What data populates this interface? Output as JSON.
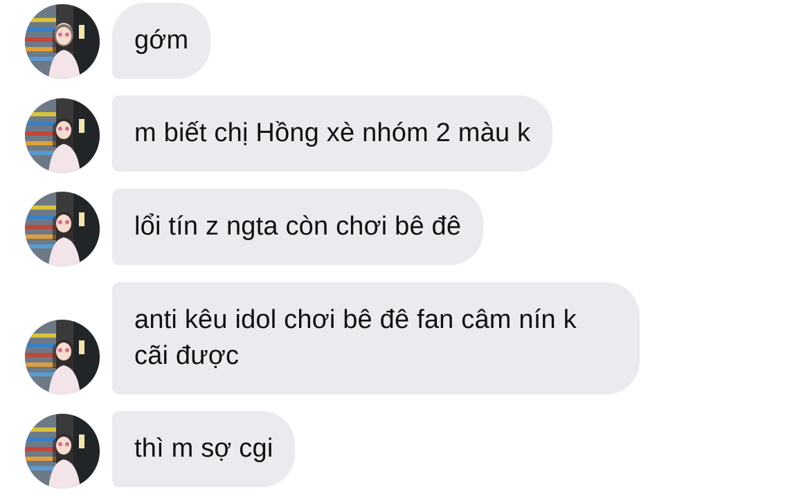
{
  "conversation": {
    "messages": [
      {
        "text": "gớm",
        "avatar": "profile-photo"
      },
      {
        "text": "m biết chị Hồng xè nhóm 2 màu k",
        "avatar": "profile-photo"
      },
      {
        "text": "lổi tín z ngta còn chơi bê đê",
        "avatar": "profile-photo"
      },
      {
        "text": "anti kêu idol chơi bê đê fan câm nín k cãi được",
        "avatar": "profile-photo"
      },
      {
        "text": "thì m sợ cgi",
        "avatar": "profile-photo"
      }
    ]
  },
  "colors": {
    "bubble_bg": "#e9ebee",
    "text": "#111111",
    "background": "#ffffff"
  }
}
